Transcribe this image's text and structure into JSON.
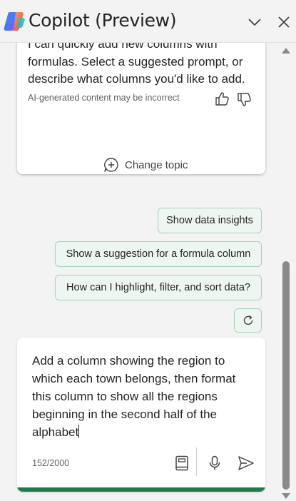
{
  "header": {
    "title": "Copilot (Preview)",
    "collapse_icon": "chevron-down-icon",
    "close_icon": "close-icon"
  },
  "message": {
    "text": "I can quickly add new columns with formulas. Select a suggested prompt, or describe what columns you'd like to add.",
    "disclaimer": "AI-generated content may be incorrect"
  },
  "change_topic": {
    "label": "Change topic"
  },
  "suggestions": [
    "Show data insights",
    "Show a suggestion for a formula column",
    "How can I highlight, filter, and sort data?"
  ],
  "composer": {
    "text": "Add a column showing the region to which each town belongs, then format this column to show all the regions beginning in the second half of the alphabet",
    "counter": "152/2000"
  },
  "colors": {
    "accent_green": "#1f7a4d",
    "chip_border": "#a7d1b8",
    "chip_bg": "#eef6f1"
  }
}
